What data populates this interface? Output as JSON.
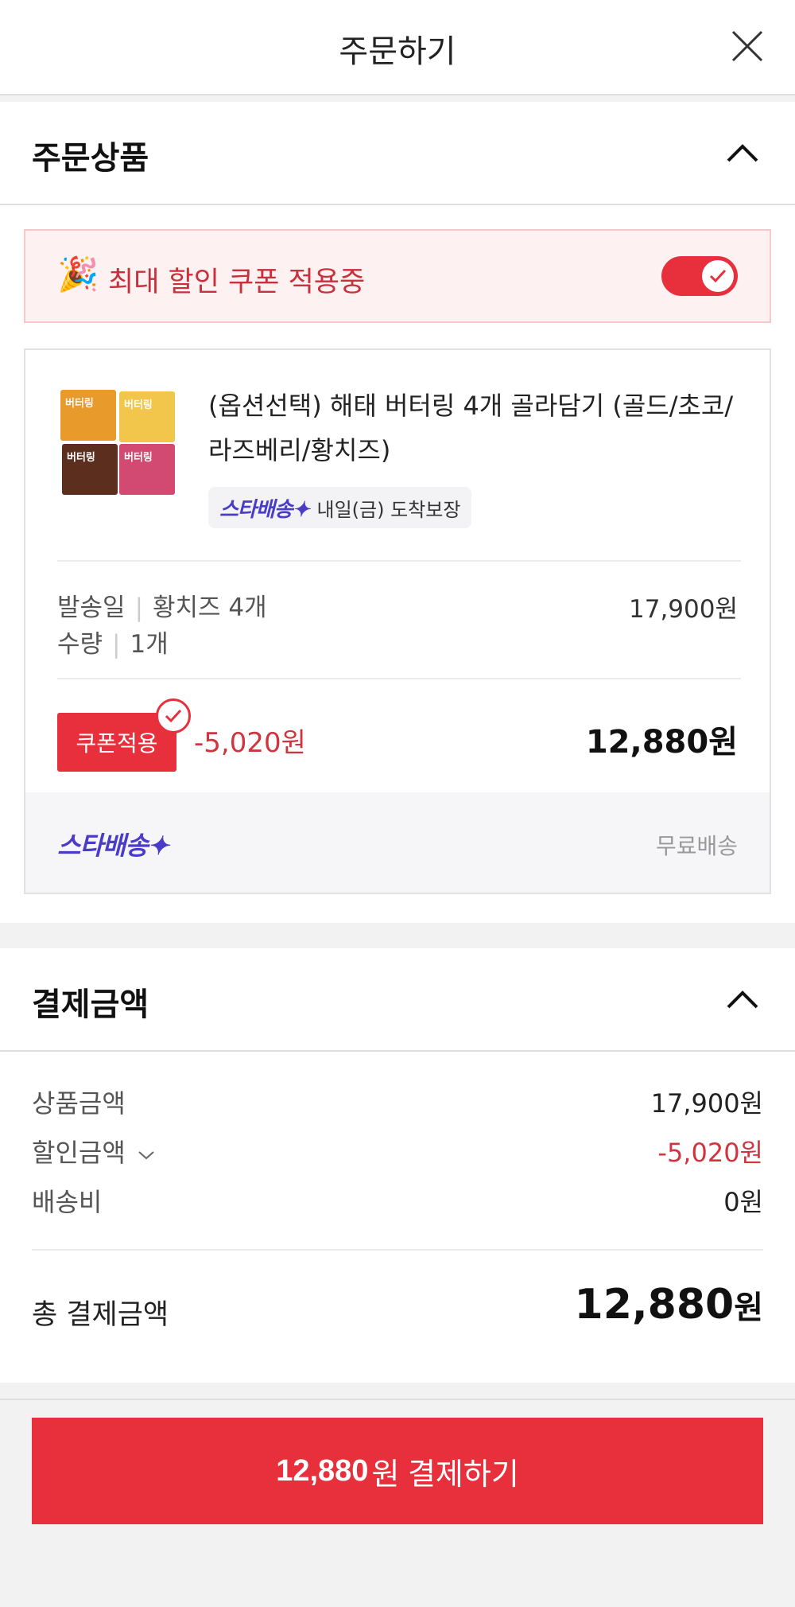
{
  "header": {
    "title": "주문하기"
  },
  "order_items": {
    "section_title": "주문상품",
    "coupon_banner": {
      "text": "최대 할인 쿠폰 적용중",
      "toggle_on": true
    },
    "product": {
      "name": "(옵션선택) 해태 버터링 4개 골라담기 (골드/초코/라즈베리/황치즈)",
      "thumbnail_label": "버터링",
      "shipping_logo": "스타배송",
      "shipping_desc": "내일(금) 도착보장",
      "option_label": "발송일",
      "option_value": "황치즈 4개",
      "quantity_label": "수량",
      "quantity_value": "1개",
      "original_price": "17,900원",
      "coupon_button": "쿠폰적용",
      "discount": "-5,020원",
      "final_price": "12,880원",
      "footer_logo": "스타배송",
      "footer_shipping": "무료배송"
    }
  },
  "payment": {
    "section_title": "결제금액",
    "rows": [
      {
        "label": "상품금액",
        "value": "17,900원"
      },
      {
        "label": "할인금액",
        "value": "-5,020원"
      },
      {
        "label": "배송비",
        "value": "0원"
      }
    ],
    "total_label": "총 결제금액",
    "total_value": "12,880",
    "total_unit": "원"
  },
  "pay_button": {
    "amount": "12,880",
    "suffix": "원 결제하기"
  },
  "colors": {
    "accent": "#e8303c",
    "star_logo": "#4a3cc8",
    "discount_text": "#d0353f"
  }
}
